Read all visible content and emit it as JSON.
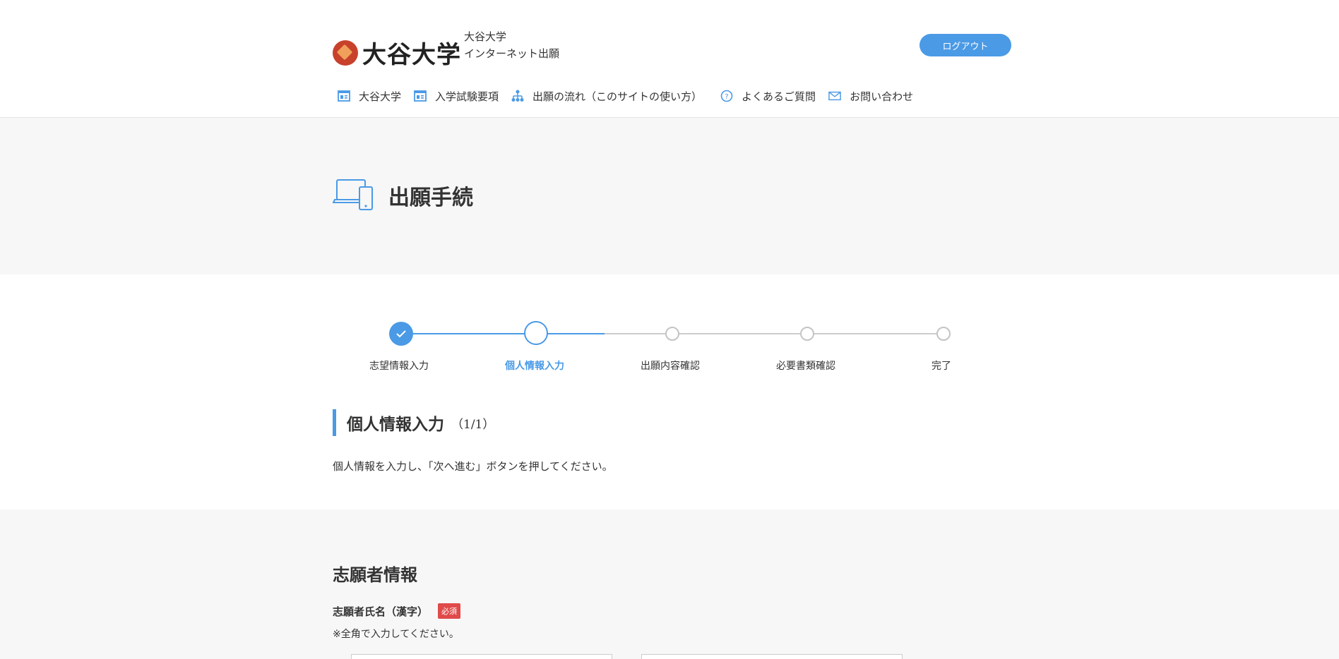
{
  "header": {
    "logo_text": "大谷大学",
    "site_name_line1": "大谷大学",
    "site_name_line2": "インターネット出願",
    "logout_label": "ログアウト"
  },
  "nav": {
    "items": [
      {
        "label": "大谷大学",
        "icon": "document-icon"
      },
      {
        "label": "入学試験要項",
        "icon": "document-icon"
      },
      {
        "label": "出願の流れ（このサイトの使い方）",
        "icon": "flow-icon"
      },
      {
        "label": "よくあるご質問",
        "icon": "question-icon"
      },
      {
        "label": "お問い合わせ",
        "icon": "mail-icon"
      }
    ]
  },
  "page": {
    "title": "出願手続"
  },
  "stepper": {
    "current_step": 2,
    "steps": [
      {
        "label": "志望情報入力",
        "state": "done"
      },
      {
        "label": "個人情報入力",
        "state": "current"
      },
      {
        "label": "出願内容確認",
        "state": "todo"
      },
      {
        "label": "必要書類確認",
        "state": "todo"
      },
      {
        "label": "完了",
        "state": "todo"
      }
    ]
  },
  "section": {
    "title": "個人情報入力",
    "page_indicator": "（1/1）",
    "instruction": "個人情報を入力し、「次へ進む」ボタンを押してください。"
  },
  "form": {
    "heading": "志願者情報",
    "name_kanji_label": "志願者氏名（漢字）",
    "required_badge": "必須",
    "name_kanji_note": "※全角で入力してください。"
  },
  "colors": {
    "accent": "#4a9ae6",
    "required": "#e04a4a",
    "band": "#f7f7f7"
  }
}
